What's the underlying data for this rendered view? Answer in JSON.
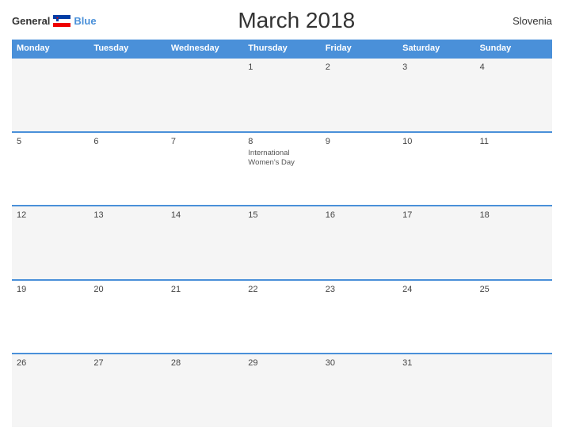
{
  "header": {
    "logo_general": "General",
    "logo_blue": "Blue",
    "title": "March 2018",
    "country": "Slovenia"
  },
  "weekdays": [
    "Monday",
    "Tuesday",
    "Wednesday",
    "Thursday",
    "Friday",
    "Saturday",
    "Sunday"
  ],
  "weeks": [
    [
      {
        "day": "",
        "holiday": ""
      },
      {
        "day": "",
        "holiday": ""
      },
      {
        "day": "",
        "holiday": ""
      },
      {
        "day": "1",
        "holiday": ""
      },
      {
        "day": "2",
        "holiday": ""
      },
      {
        "day": "3",
        "holiday": ""
      },
      {
        "day": "4",
        "holiday": ""
      }
    ],
    [
      {
        "day": "5",
        "holiday": ""
      },
      {
        "day": "6",
        "holiday": ""
      },
      {
        "day": "7",
        "holiday": ""
      },
      {
        "day": "8",
        "holiday": "International Women's Day"
      },
      {
        "day": "9",
        "holiday": ""
      },
      {
        "day": "10",
        "holiday": ""
      },
      {
        "day": "11",
        "holiday": ""
      }
    ],
    [
      {
        "day": "12",
        "holiday": ""
      },
      {
        "day": "13",
        "holiday": ""
      },
      {
        "day": "14",
        "holiday": ""
      },
      {
        "day": "15",
        "holiday": ""
      },
      {
        "day": "16",
        "holiday": ""
      },
      {
        "day": "17",
        "holiday": ""
      },
      {
        "day": "18",
        "holiday": ""
      }
    ],
    [
      {
        "day": "19",
        "holiday": ""
      },
      {
        "day": "20",
        "holiday": ""
      },
      {
        "day": "21",
        "holiday": ""
      },
      {
        "day": "22",
        "holiday": ""
      },
      {
        "day": "23",
        "holiday": ""
      },
      {
        "day": "24",
        "holiday": ""
      },
      {
        "day": "25",
        "holiday": ""
      }
    ],
    [
      {
        "day": "26",
        "holiday": ""
      },
      {
        "day": "27",
        "holiday": ""
      },
      {
        "day": "28",
        "holiday": ""
      },
      {
        "day": "29",
        "holiday": ""
      },
      {
        "day": "30",
        "holiday": ""
      },
      {
        "day": "31",
        "holiday": ""
      },
      {
        "day": "",
        "holiday": ""
      }
    ]
  ]
}
